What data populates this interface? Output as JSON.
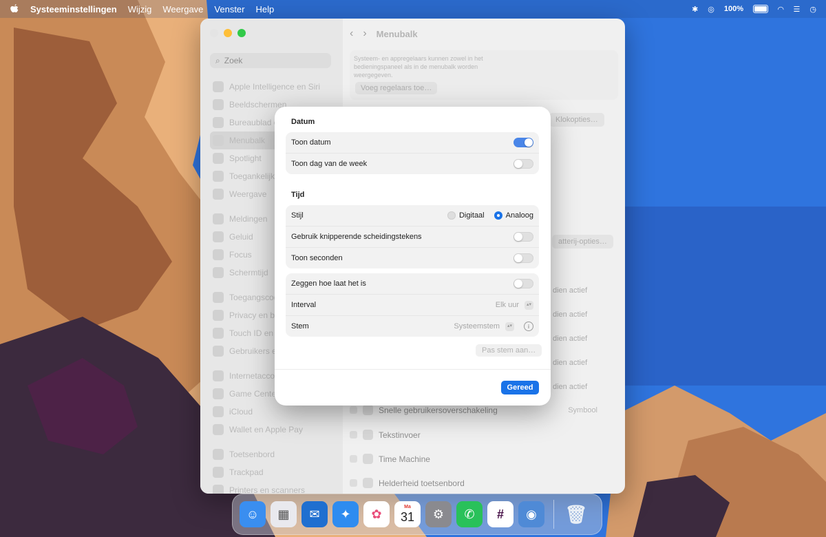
{
  "menubar": {
    "app_name": "Systeeminstellingen",
    "menus": [
      "Wijzig",
      "Weergave",
      "Venster",
      "Help"
    ],
    "battery": "100%"
  },
  "window": {
    "title": "Menubalk",
    "search_placeholder": "Zoek",
    "sidebar": {
      "items": [
        "Apple Intelligence en Siri",
        "Beeldschermen",
        "Bureaublad en Dock",
        "Menubalk",
        "Spotlight",
        "Toegankelijkheid",
        "Weergave",
        "Meldingen",
        "Geluid",
        "Focus",
        "Schermtijd",
        "Toegangscode",
        "Privacy en beveiliging",
        "Touch ID en wachtwoord",
        "Gebruikers en groepen",
        "Internetaccounts",
        "Game Center",
        "iCloud",
        "Wallet en Apple Pay",
        "Toetsenbord",
        "Trackpad",
        "Printers en scanners"
      ],
      "selected": "Menubalk"
    },
    "content": {
      "info_text": "Systeem- en appregelaars kunnen zowel in het bedieningspaneel als in de menubalk worden weergegeven.",
      "add_controls_label": "Voeg regelaars toe…",
      "clock_options_label": "Klokopties…",
      "battery_options_label": "atterij-opties…",
      "when_active": "dien actief",
      "rows": [
        {
          "label": "Snelle gebruikersoverschakeling",
          "value": "Symbool"
        },
        {
          "label": "Tekstinvoer"
        },
        {
          "label": "Time Machine"
        },
        {
          "label": "Helderheid toetsenbord"
        }
      ]
    }
  },
  "sheet": {
    "date_section": "Datum",
    "show_date": "Toon datum",
    "show_weekday": "Toon dag van de week",
    "time_section": "Tijd",
    "style_label": "Stijl",
    "style_options": [
      "Digitaal",
      "Analoog"
    ],
    "style_selected": "Analoog",
    "blink_separators": "Gebruik knipperende scheidingstekens",
    "show_seconds": "Toon seconden",
    "announce_time": "Zeggen hoe laat het is",
    "interval_label": "Interval",
    "interval_value": "Elk uur",
    "voice_label": "Stem",
    "voice_value": "Systeemstem",
    "customize_voice": "Pas stem aan…",
    "done": "Gereed",
    "toggles": {
      "show_date": true,
      "show_weekday": false,
      "blink_separators": false,
      "show_seconds": false,
      "announce_time": false
    }
  },
  "dock": {
    "calendar_month": "Ma",
    "calendar_day": "31"
  }
}
